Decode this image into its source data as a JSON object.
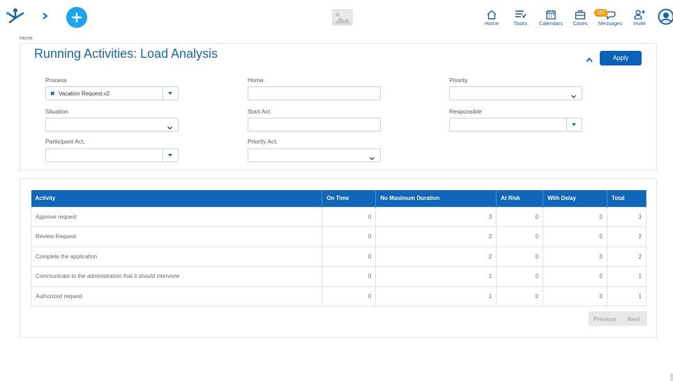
{
  "topbar": {
    "nav": [
      {
        "label": "Home",
        "icon": "home-icon"
      },
      {
        "label": "Tasks",
        "icon": "tasks-icon"
      },
      {
        "label": "Calendars",
        "icon": "calendar-icon"
      },
      {
        "label": "Cases",
        "icon": "briefcase-icon"
      },
      {
        "label": "Messages",
        "icon": "messages-icon"
      },
      {
        "label": "Invite",
        "icon": "invite-icon"
      }
    ],
    "messages_badge": "117"
  },
  "breadcrumb": "Home",
  "page": {
    "title": "Running Activities: Load Analysis",
    "apply_label": "Apply"
  },
  "filters": {
    "process": {
      "label": "Process",
      "value": "Vacation Request.v2"
    },
    "home": {
      "label": "Home",
      "value": ""
    },
    "priority": {
      "label": "Priority",
      "value": ""
    },
    "situation": {
      "label": "Situation",
      "value": ""
    },
    "start_act": {
      "label": "Start Act.",
      "value": ""
    },
    "responsible": {
      "label": "Responsible",
      "value": ""
    },
    "participant_act": {
      "label": "Participant Act.",
      "value": ""
    },
    "priority_act": {
      "label": "Priority Act.",
      "value": ""
    }
  },
  "table": {
    "columns": [
      "Activity",
      "On Time",
      "No Maximum Duration",
      "At Risk",
      "With Delay",
      "Total"
    ],
    "rows": [
      [
        "Approve request",
        "0",
        "3",
        "0",
        "0",
        "3"
      ],
      [
        "Review Request",
        "0",
        "2",
        "0",
        "0",
        "2"
      ],
      [
        "Complete the application",
        "0",
        "2",
        "0",
        "0",
        "2"
      ],
      [
        "Communicate to the administration that it should intervene",
        "0",
        "1",
        "0",
        "0",
        "1"
      ],
      [
        "Authorized request",
        "0",
        "1",
        "0",
        "0",
        "1"
      ]
    ]
  },
  "pager": {
    "previous": "Previous",
    "next": "Next"
  },
  "colors": {
    "brand": "#1066b8",
    "add": "#1ca4ee",
    "badge": "#f39c12"
  }
}
